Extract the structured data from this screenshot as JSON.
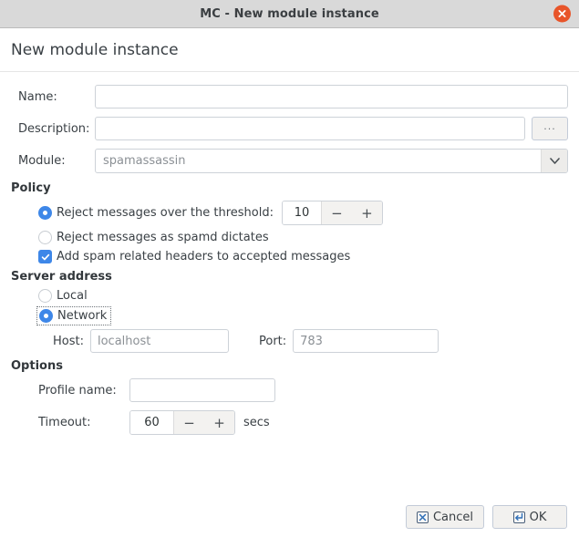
{
  "window": {
    "title": "MC - New module instance",
    "close_icon": "close-circle-icon"
  },
  "header": {
    "title": "New module instance"
  },
  "form": {
    "name": {
      "label": "Name:",
      "value": "",
      "placeholder": ""
    },
    "description": {
      "label": "Description:",
      "value": "",
      "placeholder": "",
      "browse_label": "..."
    },
    "module": {
      "label": "Module:",
      "value": "spamassassin",
      "arrow_icon": "chevron-down-icon"
    }
  },
  "policy": {
    "title": "Policy",
    "reject_threshold": {
      "label": "Reject messages over the threshold:",
      "selected": true,
      "value": "10",
      "minus_label": "−",
      "plus_label": "+"
    },
    "reject_spamd": {
      "label": "Reject messages as spamd dictates",
      "selected": false
    },
    "add_headers": {
      "label": "Add spam related headers to accepted messages",
      "checked": true,
      "check_icon": "check-icon"
    }
  },
  "server_address": {
    "title": "Server address",
    "local": {
      "label": "Local",
      "selected": false
    },
    "network": {
      "label": "Network",
      "selected": true,
      "focused": true
    },
    "host": {
      "label": "Host:",
      "value": "localhost"
    },
    "port": {
      "label": "Port:",
      "value": "783"
    }
  },
  "options": {
    "title": "Options",
    "profile_name": {
      "label": "Profile name:",
      "value": "",
      "placeholder": ""
    },
    "timeout": {
      "label": "Timeout:",
      "value": "60",
      "minus_label": "−",
      "plus_label": "+",
      "units": "secs"
    }
  },
  "footer": {
    "cancel": {
      "label": "Cancel",
      "icon": "cancel-box-icon"
    },
    "ok": {
      "label": "OK",
      "icon": "enter-key-icon"
    }
  },
  "colors": {
    "accent": "#3e87e8",
    "close": "#e8552a",
    "titlebar": "#d9d9d9",
    "text": "#3a4045"
  }
}
